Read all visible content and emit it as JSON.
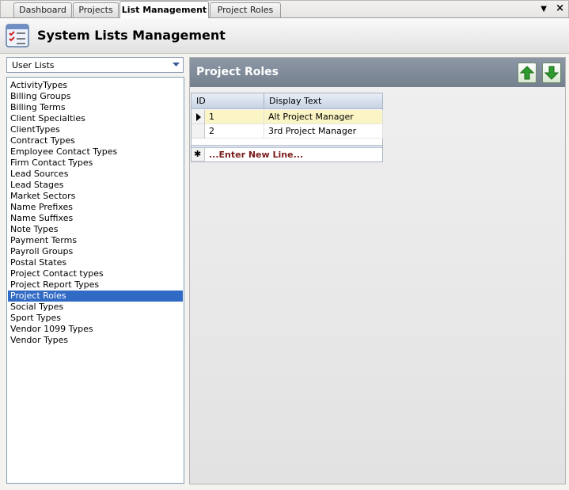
{
  "tabs": [
    {
      "label": "Dashboard",
      "active": false
    },
    {
      "label": "Projects",
      "active": false
    },
    {
      "label": "List Management",
      "active": true
    },
    {
      "label": "Project Roles",
      "active": false
    }
  ],
  "window_controls": {
    "menu_glyph": "▼",
    "close_glyph": "×"
  },
  "header": {
    "title": "System Lists Management",
    "icon": "checklist-icon"
  },
  "list_selector": {
    "selected": "User Lists",
    "arrow_glyph": "▾"
  },
  "list_items": [
    "ActivityTypes",
    "Billing Groups",
    "Billing Terms",
    "Client Specialties",
    "ClientTypes",
    "Contract Types",
    "Employee Contact Types",
    "Firm Contact Types",
    "Lead Sources",
    "Lead Stages",
    "Market Sectors",
    "Name Prefixes",
    "Name Suffixes",
    "Note Types",
    "Payment Terms",
    "Payroll Groups",
    "Postal States",
    "Project Contact types",
    "Project Report Types",
    "Project Roles",
    "Social Types",
    "Sport Types",
    "Vendor 1099 Types",
    "Vendor Types"
  ],
  "selected_list_item": "Project Roles",
  "panel": {
    "title": "Project Roles",
    "move_up_icon": "arrow-up-icon",
    "move_down_icon": "arrow-down-icon",
    "accent_color": "#2e9b2e"
  },
  "grid": {
    "columns": [
      "ID",
      "Display Text"
    ],
    "rows": [
      {
        "id": "1",
        "text": "Alt Project Manager",
        "current": true
      },
      {
        "id": "2",
        "text": "3rd Project Manager",
        "current": false
      }
    ],
    "new_line_glyph": "✱",
    "new_line_text": "...Enter New Line..."
  }
}
